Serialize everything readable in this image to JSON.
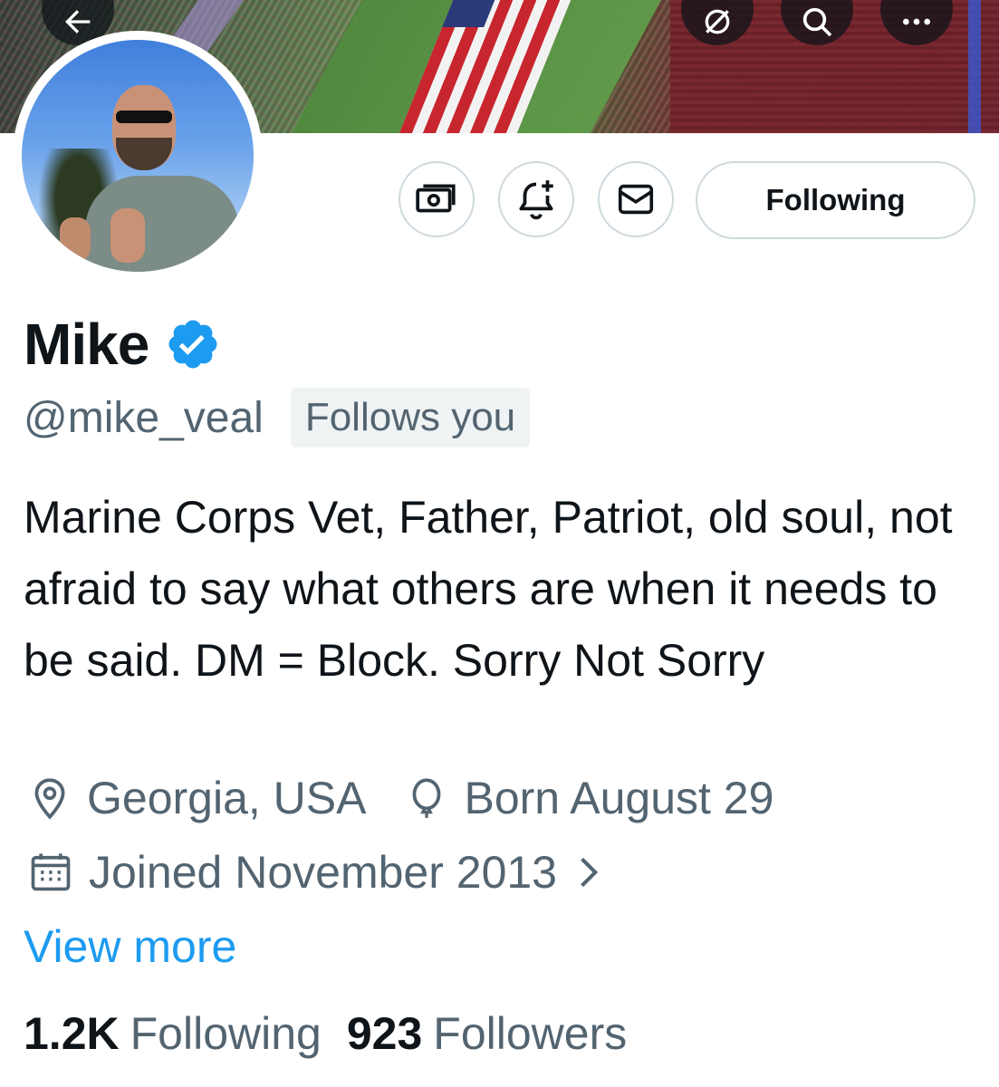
{
  "profile": {
    "display_name": "Mike",
    "handle": "@mike_veal",
    "follows_you_badge": "Follows you",
    "bio": "Marine Corps Vet, Father, Patriot, old soul, not afraid to say what others are when it needs to be said. DM = Block. Sorry Not Sorry",
    "location": "Georgia, USA",
    "birthday": "Born August 29",
    "joined": "Joined November 2013",
    "view_more": "View more",
    "verified_color": "#1d9bf0"
  },
  "actions": {
    "following_label": "Following",
    "tip_icon": "money-icon",
    "notify_icon": "bell-plus-icon",
    "message_icon": "envelope-icon"
  },
  "nav": {
    "back_icon": "arrow-left-icon",
    "grok_icon": "grok-icon",
    "search_icon": "search-icon",
    "more_icon": "more-icon"
  },
  "stats": {
    "following_count": "1.2K",
    "following_label": "Following",
    "followers_count": "923",
    "followers_label": "Followers"
  },
  "colors": {
    "accent": "#1d9bf0",
    "secondary_text": "#536471",
    "border": "#cfd9de"
  }
}
